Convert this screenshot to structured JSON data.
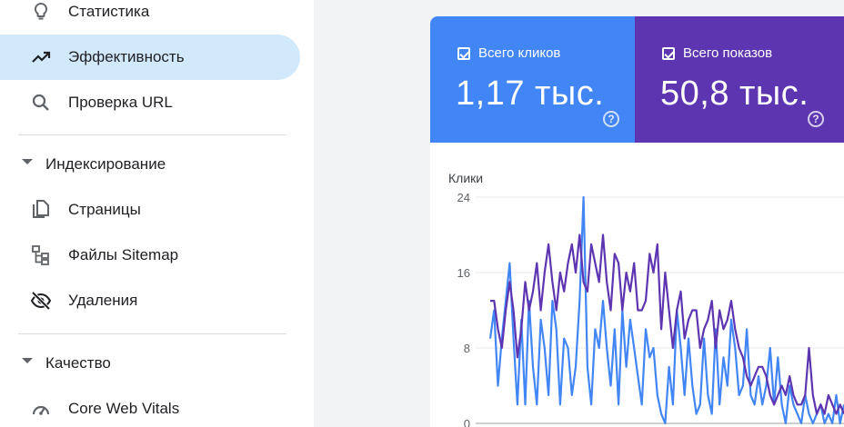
{
  "sidebar": {
    "items": [
      {
        "label": "Статистика",
        "icon": "lightbulb-icon"
      },
      {
        "label": "Эффективность",
        "icon": "trending-up-icon",
        "active": true
      },
      {
        "label": "Проверка URL",
        "icon": "search-icon"
      }
    ],
    "sections": [
      {
        "title": "Индексирование",
        "items": [
          {
            "label": "Страницы",
            "icon": "pages-icon"
          },
          {
            "label": "Файлы Sitemap",
            "icon": "sitemap-icon"
          },
          {
            "label": "Удаления",
            "icon": "visibility-off-icon"
          }
        ]
      },
      {
        "title": "Качество",
        "items": [
          {
            "label": "Core Web Vitals",
            "icon": "speed-gauge-icon"
          }
        ]
      }
    ]
  },
  "metrics": {
    "clicks": {
      "label": "Всего кликов",
      "value": "1,17 тыс.",
      "color": "#4285f4",
      "checked": true
    },
    "impressions": {
      "label": "Всего показов",
      "value": "50,8 тыс.",
      "color": "#5e35b1",
      "checked": true
    }
  },
  "chart_data": {
    "type": "line",
    "ylabel": "Клики",
    "ylim": [
      0,
      24
    ],
    "yticks": [
      "0",
      "8",
      "16",
      "24"
    ],
    "grid": true,
    "series": [
      {
        "color": "#4285f4",
        "values": [
          9,
          12,
          4,
          9,
          13,
          17,
          9,
          2,
          11,
          2,
          13,
          6,
          2,
          11,
          8,
          3,
          13,
          10,
          2,
          9,
          8,
          3,
          6,
          13,
          24,
          6,
          2,
          10,
          8,
          13,
          8,
          4,
          10,
          2,
          12,
          6,
          11,
          8,
          5,
          2,
          10,
          7,
          8,
          3,
          1,
          0,
          6,
          2,
          12,
          8,
          3,
          9,
          4,
          1,
          2,
          9,
          3,
          1,
          10,
          2,
          7,
          4,
          11,
          8,
          3,
          4,
          10,
          3,
          2,
          5,
          2,
          4,
          8,
          2,
          7,
          2,
          0,
          4,
          2,
          1,
          0,
          3,
          1,
          0,
          1,
          2,
          0,
          1,
          0,
          3,
          0,
          2
        ]
      },
      {
        "color": "#5e35b1",
        "values": [
          13,
          13,
          10,
          8,
          12,
          15,
          12,
          7,
          10,
          15,
          12,
          14,
          17,
          12,
          16,
          19,
          15,
          12,
          16,
          14,
          17,
          19,
          16,
          20,
          15,
          14,
          19,
          17,
          15,
          20,
          15,
          12,
          18,
          17,
          12,
          16,
          14,
          17,
          12,
          12,
          13,
          18,
          16,
          19,
          10,
          16,
          12,
          8,
          12,
          14,
          9,
          11,
          12,
          12,
          8,
          10,
          11,
          13,
          8,
          12,
          10,
          11,
          13,
          10,
          8,
          7,
          5,
          4,
          5,
          6,
          6,
          5,
          3,
          2,
          3,
          4,
          3,
          5,
          3,
          2,
          2,
          3,
          8,
          3,
          1,
          2,
          1,
          3,
          2,
          1,
          2,
          1
        ]
      }
    ]
  }
}
